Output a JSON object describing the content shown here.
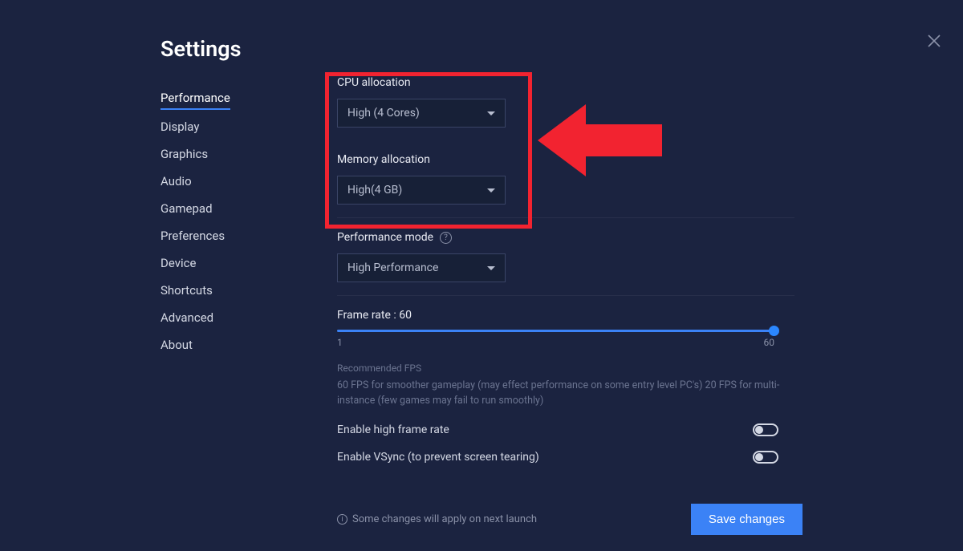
{
  "title": "Settings",
  "sidebar": {
    "items": [
      {
        "label": "Performance",
        "active": true
      },
      {
        "label": "Display"
      },
      {
        "label": "Graphics"
      },
      {
        "label": "Audio"
      },
      {
        "label": "Gamepad"
      },
      {
        "label": "Preferences"
      },
      {
        "label": "Device"
      },
      {
        "label": "Shortcuts"
      },
      {
        "label": "Advanced"
      },
      {
        "label": "About"
      }
    ]
  },
  "cpu": {
    "label": "CPU allocation",
    "value": "High (4 Cores)"
  },
  "memory": {
    "label": "Memory allocation",
    "value": "High(4 GB)"
  },
  "perf_mode": {
    "label": "Performance mode",
    "value": "High Performance"
  },
  "frame_rate": {
    "label": "Frame rate : 60",
    "min": "1",
    "max": "60",
    "value": 60
  },
  "recommended": {
    "title": "Recommended FPS",
    "body": "60 FPS for smoother gameplay (may effect performance on some entry level PC's) 20 FPS for multi-instance (few games may fail to run smoothly)"
  },
  "toggles": {
    "high_frame": "Enable high frame rate",
    "vsync": "Enable VSync (to prevent screen tearing)"
  },
  "footer": {
    "note": "Some changes will apply on next launch",
    "save": "Save changes"
  }
}
